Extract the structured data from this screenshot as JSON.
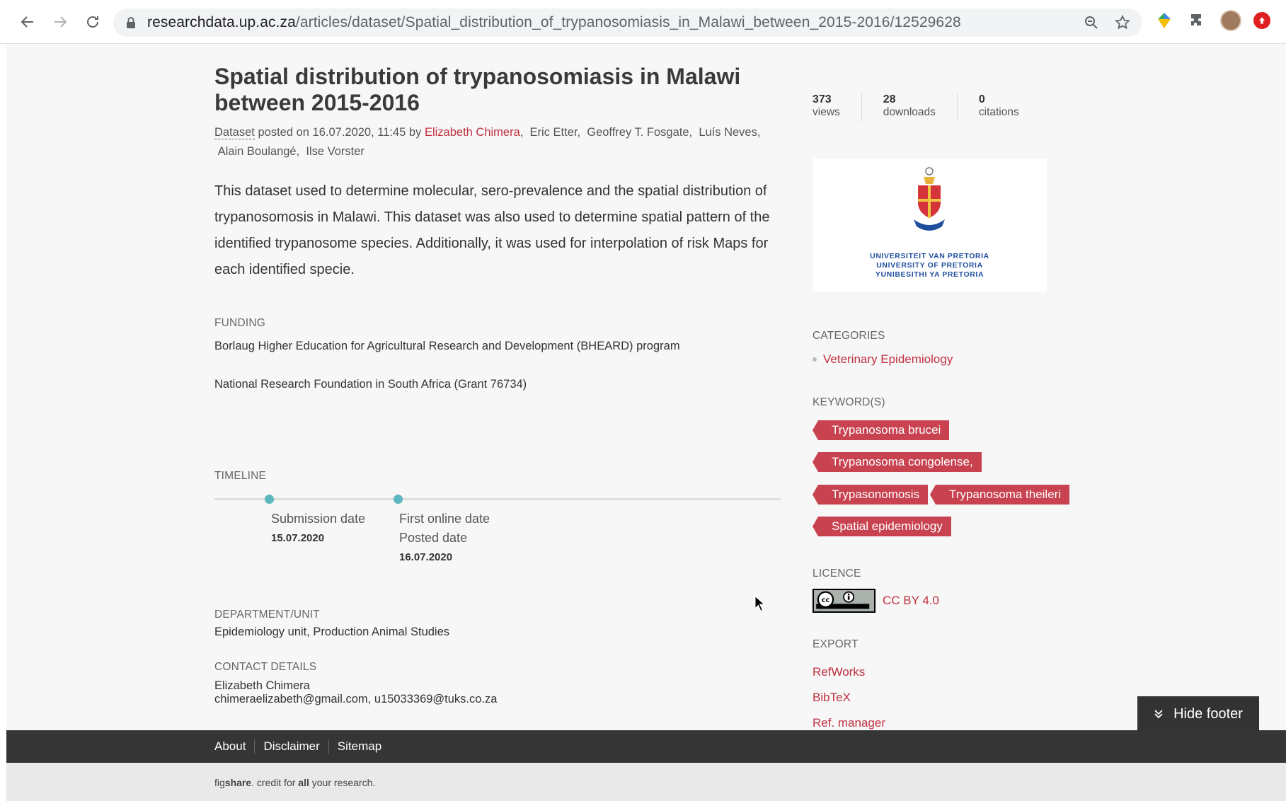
{
  "browser": {
    "url_host": "researchdata.up.ac.za",
    "url_path": "/articles/dataset/Spatial_distribution_of_trypanosomiasis_in_Malawi_between_2015-2016/12529628"
  },
  "article": {
    "title": "Spatial distribution of trypanosomiasis in Malawi between 2015-2016",
    "item_type": "Dataset",
    "posted_text": "posted on 16.07.2020, 11:45 by",
    "authors": [
      "Elizabeth Chimera",
      "Eric Etter",
      "Geoffrey T. Fosgate",
      "Luís Neves",
      "Alain Boulangé",
      "Ilse Vorster"
    ],
    "description": "This dataset used to determine molecular, sero-prevalence and the spatial distribution of trypanosomosis in Malawi. This dataset was also used to determine spatial pattern of the identified trypanosome species. Additionally, it was used for interpolation of risk Maps for each identified specie."
  },
  "funding": {
    "label": "FUNDING",
    "items": [
      "Borlaug Higher Education for Agricultural Research and Development (BHEARD) program",
      "National Research Foundation in South Africa (Grant 76734)"
    ]
  },
  "timeline": {
    "label": "TIMELINE",
    "submission_label": "Submission date",
    "submission_date": "15.07.2020",
    "online_label": "First online date",
    "posted_label": "Posted date",
    "posted_date": "16.07.2020"
  },
  "department": {
    "label": "DEPARTMENT/UNIT",
    "value": "Epidemiology unit, Production Animal Studies"
  },
  "contact": {
    "label": "CONTACT DETAILS",
    "name": "Elizabeth Chimera",
    "emails": "chimeraelizabeth@gmail.com, u15033369@tuks.co.za"
  },
  "stats": [
    {
      "value": "373",
      "label": "views"
    },
    {
      "value": "28",
      "label": "downloads"
    },
    {
      "value": "0",
      "label": "citations"
    }
  ],
  "logo": {
    "line1": "UNIVERSITEIT VAN PRETORIA",
    "line2": "UNIVERSITY OF PRETORIA",
    "line3": "YUNIBESITHI YA PRETORIA"
  },
  "categories": {
    "label": "CATEGORIES",
    "items": [
      "Veterinary Epidemiology"
    ]
  },
  "keywords": {
    "label": "KEYWORD(S)",
    "items": [
      "Trypanosoma brucei",
      "Trypanosoma congolense,",
      "Trypasonomosis",
      "Trypanosoma theileri",
      "Spatial epidemiology"
    ]
  },
  "licence": {
    "label": "LICENCE",
    "value": "CC BY 4.0"
  },
  "export": {
    "label": "EXPORT",
    "items": [
      "RefWorks",
      "BibTeX",
      "Ref. manager"
    ]
  },
  "hide_footer_label": "Hide footer",
  "footer": {
    "links": [
      "About",
      "Disclaimer",
      "Sitemap"
    ],
    "credit_pre": "fig",
    "credit_brand": "share",
    "credit_mid": ". credit for ",
    "credit_bold": "all",
    "credit_post": " your research."
  },
  "colors": {
    "accent": "#c0303f",
    "tag": "#c8424f",
    "timeline_dot": "#5bb7bd",
    "footer": "#353535"
  }
}
